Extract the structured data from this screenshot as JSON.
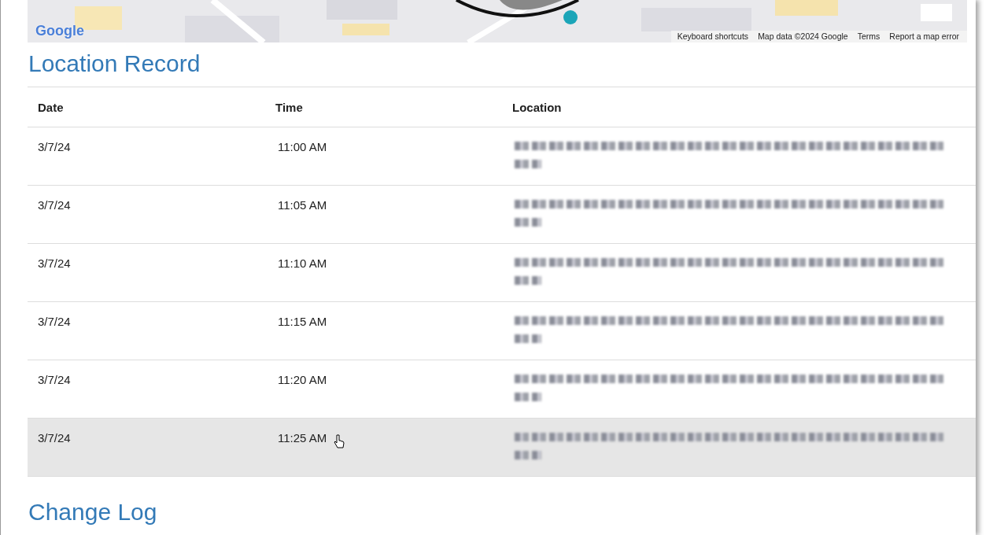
{
  "map": {
    "kind": "picture",
    "logo": "Google",
    "attribution": [
      "Keyboard shortcuts",
      "Map data ©2024 Google",
      "Terms",
      "Report a map error"
    ]
  },
  "title": "Location Record",
  "table": {
    "columns": [
      "Date",
      "Time",
      "Location"
    ],
    "rows": [
      {
        "date": "3/7/24",
        "time": "11:00 AM",
        "location_redacted": true,
        "selected": false
      },
      {
        "date": "3/7/24",
        "time": "11:05 AM",
        "location_redacted": true,
        "selected": false
      },
      {
        "date": "3/7/24",
        "time": "11:10 AM",
        "location_redacted": true,
        "selected": false
      },
      {
        "date": "3/7/24",
        "time": "11:15 AM",
        "location_redacted": true,
        "selected": false
      },
      {
        "date": "3/7/24",
        "time": "11:20 AM",
        "location_redacted": true,
        "selected": false
      },
      {
        "date": "3/7/24",
        "time": "11:25 AM",
        "location_redacted": true,
        "selected": true
      }
    ]
  },
  "next_heading": "Change Log"
}
